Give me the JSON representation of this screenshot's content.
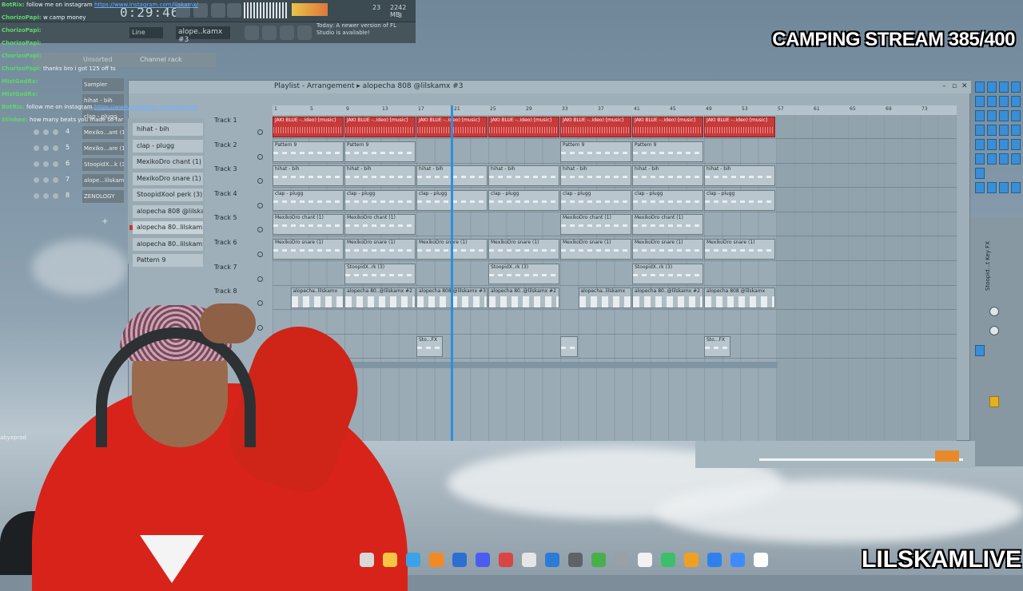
{
  "overlay": {
    "stream_title": "CAMPING STREAM 385/400",
    "brand": "LILSKAMLIVE",
    "user_handle": "abyxprod"
  },
  "toolbar": {
    "time": "0:29:46",
    "line_mode": "Line",
    "pattern_select": "alope..kamx #3",
    "cpu_value": "23",
    "memory": "2242 MB",
    "voices": "3",
    "news": "Today: A newer version of FL Studio is available!"
  },
  "channel_rack": {
    "filter": "Unsorted",
    "title": "Channel rack",
    "rows": [
      {
        "num": "",
        "name": "Sampler"
      },
      {
        "num": "",
        "name": "hihat - bih"
      },
      {
        "num": "",
        "name": "clap - plugg"
      },
      {
        "num": "4",
        "name": "Mexiko...ant (1)"
      },
      {
        "num": "5",
        "name": "Mexiko...are (1)"
      },
      {
        "num": "6",
        "name": "StoopidX...k (3)"
      },
      {
        "num": "7",
        "name": "alope...lilskamx"
      },
      {
        "num": "8",
        "name": "ZENOLOGY"
      }
    ],
    "add_label": "+"
  },
  "picker": {
    "items": [
      "hihat - bih",
      "clap - plugg",
      "MexikoDro chant (1)",
      "MexikoDro snare (1)",
      "StoopidXool perk (3)",
      "alopecha 808 @lilskamx",
      "alopecha 80..lilskamx #3",
      "alopecha 80..lilskamx #2",
      "Pattern 9"
    ]
  },
  "playlist": {
    "title": "Playlist - Arrangement",
    "pattern": "alopecha 808 @lilskamx #3",
    "ruler": [
      "1",
      "5",
      "9",
      "13",
      "17",
      "21",
      "25",
      "29",
      "33",
      "37",
      "41",
      "45",
      "49",
      "53",
      "57",
      "61",
      "65",
      "69",
      "73"
    ],
    "tracks": [
      {
        "label": "Track 1",
        "clips": [
          {
            "type": "audio",
            "text": "JAKI BLUE -..ideo) [music]",
            "start": 0,
            "len": 4
          },
          {
            "type": "audio",
            "text": "JAKI BLUE -..ideo) [music]",
            "start": 4,
            "len": 4
          },
          {
            "type": "audio",
            "text": "JAKI BLUE -..ideo) [music]",
            "start": 8,
            "len": 4
          },
          {
            "type": "audio",
            "text": "JAKI BLUE -..ideo) [music]",
            "start": 12,
            "len": 4
          },
          {
            "type": "audio",
            "text": "JAKI BLUE -..ideo) [music]",
            "start": 16,
            "len": 4
          },
          {
            "type": "audio",
            "text": "JAKI BLUE -..ideo) [music]",
            "start": 20,
            "len": 4
          },
          {
            "type": "audio",
            "text": "JAKI BLUE -..ideo) [music]",
            "start": 24,
            "len": 4
          }
        ]
      },
      {
        "label": "Track 2",
        "clips": [
          {
            "type": "pat",
            "text": "Pattern 9",
            "start": 0,
            "len": 4
          },
          {
            "type": "pat",
            "text": "Pattern 9",
            "start": 4,
            "len": 4
          },
          {
            "type": "pat",
            "text": "Pattern 9",
            "start": 16,
            "len": 4
          },
          {
            "type": "pat",
            "text": "Pattern 9",
            "start": 20,
            "len": 4
          }
        ]
      },
      {
        "label": "Track 3",
        "clips": [
          {
            "type": "pat",
            "text": "hihat - bih",
            "start": 0,
            "len": 4
          },
          {
            "type": "pat",
            "text": "hihat - bih",
            "start": 4,
            "len": 4
          },
          {
            "type": "pat",
            "text": "hihat - bih",
            "start": 8,
            "len": 4
          },
          {
            "type": "pat",
            "text": "hihat - bih",
            "start": 12,
            "len": 4
          },
          {
            "type": "pat",
            "text": "hihat - bih",
            "start": 16,
            "len": 4
          },
          {
            "type": "pat",
            "text": "hihat - bih",
            "start": 20,
            "len": 4
          },
          {
            "type": "pat",
            "text": "hihat - bih",
            "start": 24,
            "len": 4
          }
        ]
      },
      {
        "label": "Track 4",
        "clips": [
          {
            "type": "pat",
            "text": "clap - plugg",
            "start": 0,
            "len": 4
          },
          {
            "type": "pat",
            "text": "clap - plugg",
            "start": 4,
            "len": 4
          },
          {
            "type": "pat",
            "text": "clap - plugg",
            "start": 8,
            "len": 4
          },
          {
            "type": "pat",
            "text": "clap - plugg",
            "start": 12,
            "len": 4
          },
          {
            "type": "pat",
            "text": "clap - plugg",
            "start": 16,
            "len": 4
          },
          {
            "type": "pat",
            "text": "clap - plugg",
            "start": 20,
            "len": 4
          },
          {
            "type": "pat",
            "text": "clap - plugg",
            "start": 24,
            "len": 4
          }
        ]
      },
      {
        "label": "Track 5",
        "clips": [
          {
            "type": "pat",
            "text": "MexikoDro chant (1)",
            "start": 0,
            "len": 4
          },
          {
            "type": "pat",
            "text": "MexikoDro chant (1)",
            "start": 4,
            "len": 4
          },
          {
            "type": "pat",
            "text": "MexikoDro chant (1)",
            "start": 16,
            "len": 4
          },
          {
            "type": "pat",
            "text": "MexikoDro chant (1)",
            "start": 20,
            "len": 4
          }
        ]
      },
      {
        "label": "Track 6",
        "clips": [
          {
            "type": "pat",
            "text": "MexikoDro snare (1)",
            "start": 0,
            "len": 4
          },
          {
            "type": "pat",
            "text": "MexikoDro snare (1)",
            "start": 4,
            "len": 4
          },
          {
            "type": "pat",
            "text": "MexikoDro snare (1)",
            "start": 8,
            "len": 4
          },
          {
            "type": "pat",
            "text": "MexikoDro snare (1)",
            "start": 12,
            "len": 4
          },
          {
            "type": "pat",
            "text": "MexikoDro snare (1)",
            "start": 16,
            "len": 4
          },
          {
            "type": "pat",
            "text": "MexikoDro snare (1)",
            "start": 20,
            "len": 4
          },
          {
            "type": "pat",
            "text": "MexikoDro snare (1)",
            "start": 24,
            "len": 4
          }
        ]
      },
      {
        "label": "Track 7",
        "clips": [
          {
            "type": "pat",
            "text": "StoopidX..rk (3)",
            "start": 4,
            "len": 4
          },
          {
            "type": "pat",
            "text": "StoopidX..rk (3)",
            "start": 12,
            "len": 4
          },
          {
            "type": "pat",
            "text": "StoopidX..rk (3)",
            "start": 20,
            "len": 4
          }
        ]
      },
      {
        "label": "Track 8",
        "clips": [
          {
            "type": "notes",
            "text": "alopecha..lilskamx",
            "start": 1,
            "len": 3
          },
          {
            "type": "notes",
            "text": "alopecha 80..@lilskamx #2",
            "start": 4,
            "len": 4
          },
          {
            "type": "notes",
            "text": "alopecha 808 @lilskamx #3",
            "start": 8,
            "len": 4
          },
          {
            "type": "notes",
            "text": "alopecha 80..@lilskamx #2",
            "start": 12,
            "len": 4
          },
          {
            "type": "notes",
            "text": "alopecha..lilskamx",
            "start": 17,
            "len": 3
          },
          {
            "type": "notes",
            "text": "alopecha 80..@lilskamx #2",
            "start": 20,
            "len": 4
          },
          {
            "type": "notes",
            "text": "alopecha 808 @lilskamx",
            "start": 24,
            "len": 4
          }
        ]
      },
      {
        "label": "",
        "clips": []
      },
      {
        "label": "",
        "clips": [
          {
            "type": "pat",
            "text": "Sto...FX",
            "start": 8,
            "len": 1.5
          },
          {
            "type": "pat",
            "text": "",
            "start": 16,
            "len": 1
          },
          {
            "type": "pat",
            "text": "Sto...FX",
            "start": 24,
            "len": 1.5
          }
        ]
      }
    ]
  },
  "mixer": {
    "insert_label": "Stoopid...t Key FX"
  },
  "chat": [
    {
      "user": "BotRix",
      "msg": "follow me on instagram",
      "link": "https://www.instagram.com/lilskamx/"
    },
    {
      "user": "ChorizoPapi",
      "msg": "w camp money",
      "link": ""
    },
    {
      "user": "ChorizoPapi",
      "msg": "",
      "link": ""
    },
    {
      "user": "ChorizoPapi",
      "msg": "",
      "link": ""
    },
    {
      "user": "ChorizoPapi",
      "msg": "",
      "link": ""
    },
    {
      "user": "ChorizoPapi",
      "msg": "thanks bro i got 125 off ts",
      "link": ""
    },
    {
      "user": "MistGodRx",
      "msg": "",
      "link": ""
    },
    {
      "user": "MistGodRx",
      "msg": "",
      "link": ""
    },
    {
      "user": "BotRix",
      "msg": "follow me on instagram",
      "link": "https://www.instagram.com/lilskamx/"
    },
    {
      "user": "Stinkee",
      "msg": "how many beats you made so far",
      "link": ""
    }
  ],
  "colors": {
    "audio_clip": "#c63a3a",
    "playhead": "#2f8fdc",
    "mixer_accent": "#3b8ed6",
    "hoodie": "#d8231a"
  }
}
